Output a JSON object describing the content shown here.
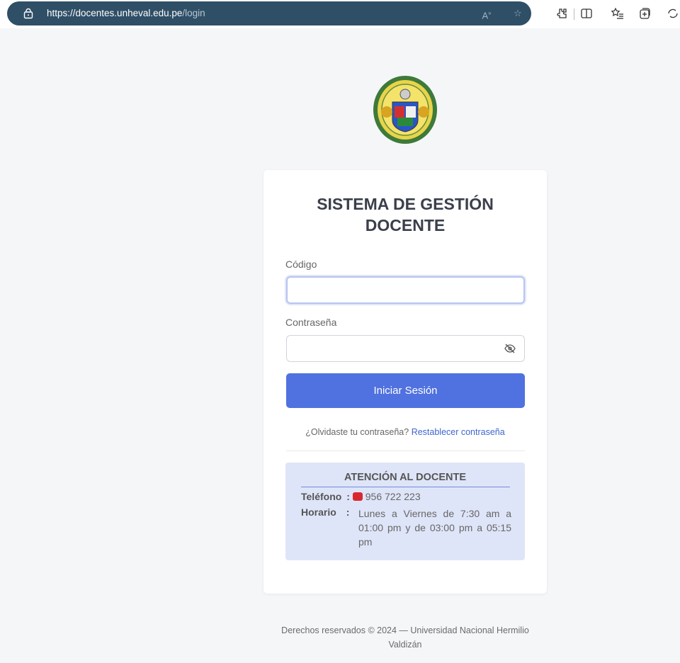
{
  "browser": {
    "url_host": "https://docentes.unheval.edu.pe",
    "url_path": "/login",
    "read_aloud_icon": "read-aloud-icon",
    "favorite_icon": "star-icon",
    "extensions_icon": "extensions-icon",
    "split_icon": "split-screen-icon",
    "favorites_icon": "favorites-list-icon",
    "collections_icon": "collections-icon",
    "more_icon": "browser-essentials-icon"
  },
  "login": {
    "title": "SISTEMA DE GESTIÓN DOCENTE",
    "code_label": "Código",
    "code_value": "",
    "password_label": "Contraseña",
    "password_value": "",
    "submit_label": "Iniciar Sesión",
    "forgot_text": "¿Olvidaste tu contraseña?",
    "reset_link": "Restablecer contraseña"
  },
  "support": {
    "title": "ATENCIÓN AL DOCENTE",
    "phone_key": "Teléfono",
    "phone_sep": ":",
    "phone_value": "956 722 223",
    "hours_key": "Horario",
    "hours_sep": ":",
    "hours_value": "Lunes a Viernes de 7:30 am a 01:00 pm y de 03:00 pm a 05:15 pm"
  },
  "footer": {
    "text": "Derechos reservados © 2024 — Universidad Nacional Hermilio Valdizán"
  },
  "colors": {
    "primary": "#5071e0",
    "link": "#3f66cf",
    "info_bg": "#dfe5f8",
    "url_bar": "#2f4f66"
  }
}
